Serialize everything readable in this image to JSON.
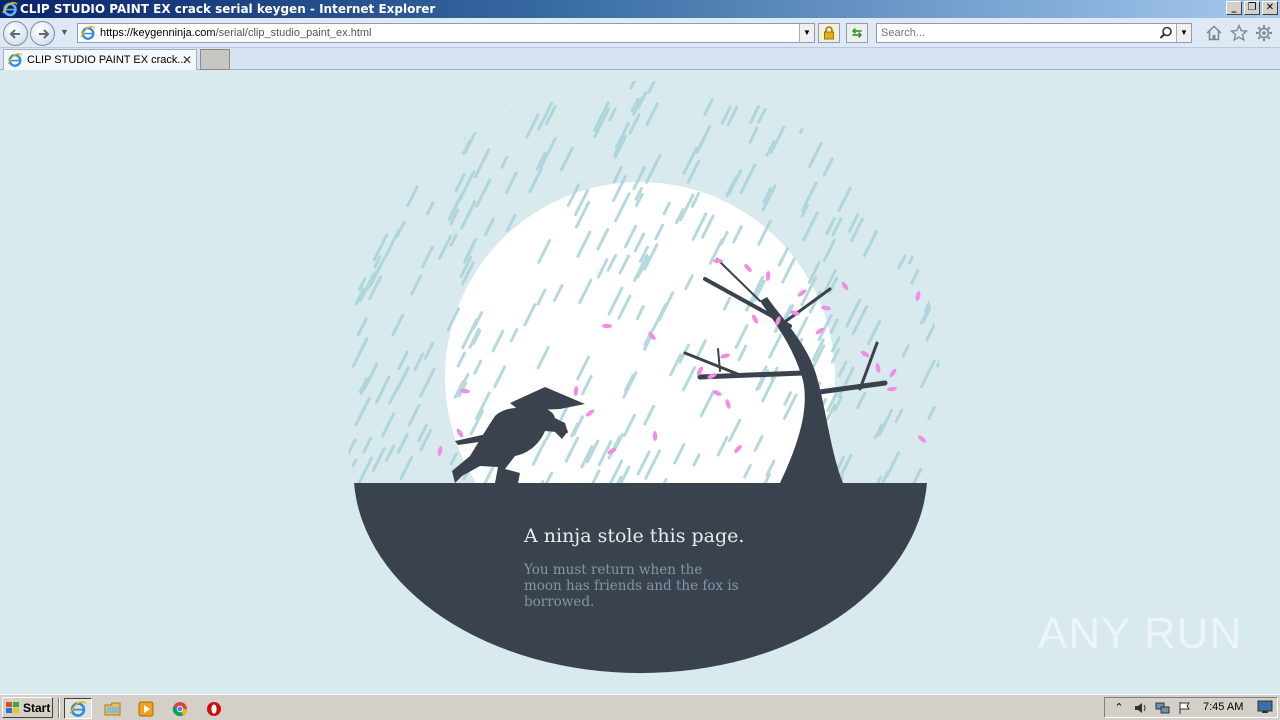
{
  "window": {
    "title": "CLIP STUDIO PAINT EX crack serial keygen - Internet Explorer",
    "min_label": "_",
    "restore_label": "❐",
    "close_label": "✕"
  },
  "navbar": {
    "url_host": "https://keygenninja.com",
    "url_path": "/serial/clip_studio_paint_ex.html",
    "search_placeholder": "Search..."
  },
  "tabs": [
    {
      "label": "CLIP STUDIO PAINT EX crack..."
    }
  ],
  "page": {
    "headline": "A ninja stole this page.",
    "subtext": "You must return when the moon has friends and the fox is borrowed.",
    "watermark": "ANY RUN",
    "colors": {
      "background": "#d8eaee",
      "ground": "#3a434d",
      "moon": "#ffffff",
      "rain": "#a9d3d8",
      "petal": "#f08ee6"
    }
  },
  "taskbar": {
    "start_label": "Start",
    "clock": "7:45 AM",
    "quick_launch": [
      "ie-icon",
      "folder-icon",
      "media-player-icon",
      "chrome-icon",
      "opera-icon"
    ]
  }
}
